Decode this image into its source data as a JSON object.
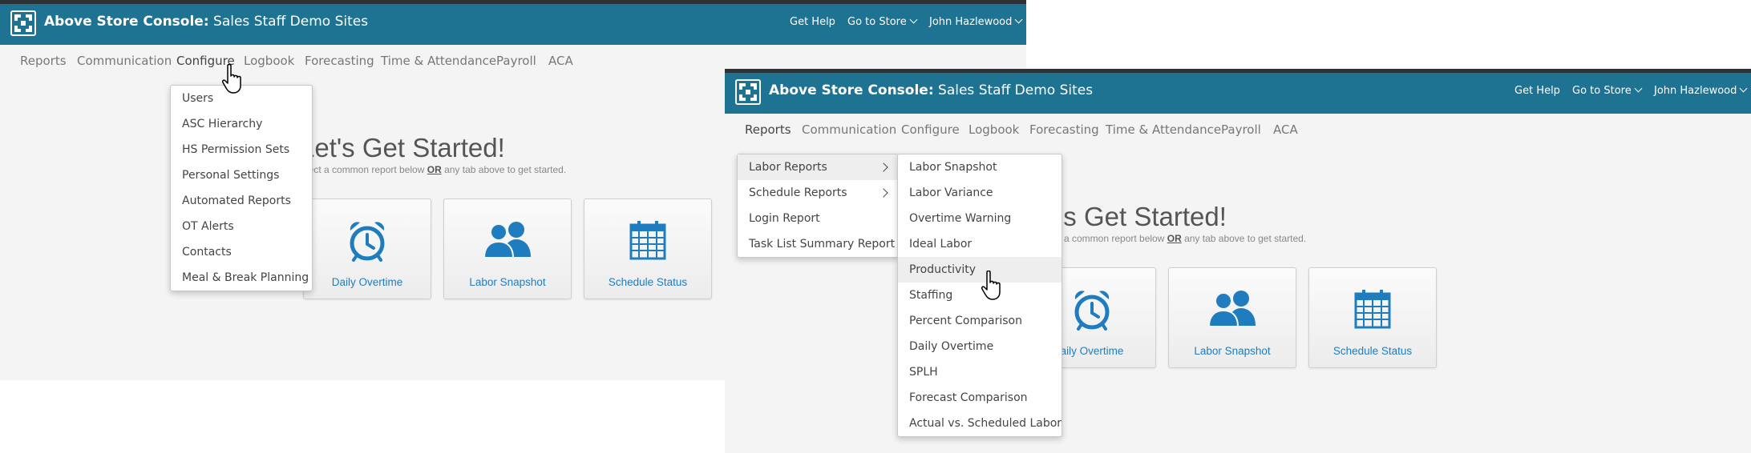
{
  "app": {
    "brand_bold": "Above Store Console:",
    "brand_rest": " Sales Staff Demo Sites",
    "get_help": "Get Help",
    "go_to_store": "Go to Store",
    "user_name": "John Hazlewood",
    "header_color": "#1e7393"
  },
  "nav": [
    "Reports",
    "Communication",
    "Configure",
    "Logbook",
    "Forecasting",
    "Time & Attendance",
    "Payroll",
    "ACA"
  ],
  "main": {
    "title_left": "Let's Get Started!",
    "title_right": "'s Get Started!",
    "sub_left_a": "lect a common report below ",
    "sub_right_a": "a common report below ",
    "sub_or": "OR",
    "sub_b": " any tab above to get started.",
    "cards": [
      "Daily Overtime",
      "Labor Snapshot",
      "Schedule Status"
    ],
    "card_right_first": "aily Overtime",
    "link_color": "#1f7dbf"
  },
  "configure_menu": [
    "Users",
    "ASC Hierarchy",
    "HS Permission Sets",
    "Personal Settings",
    "Automated Reports",
    "OT Alerts",
    "Contacts",
    "Meal & Break Planning"
  ],
  "reports_menu": [
    "Labor Reports",
    "Schedule Reports",
    "Login Report",
    "Task List Summary Report"
  ],
  "labor_submenu": [
    "Labor Snapshot",
    "Labor Variance",
    "Overtime Warning",
    "Ideal Labor",
    "Productivity",
    "Staffing",
    "Percent Comparison",
    "Daily Overtime",
    "SPLH",
    "Forecast Comparison",
    "Actual vs. Scheduled Labor"
  ]
}
